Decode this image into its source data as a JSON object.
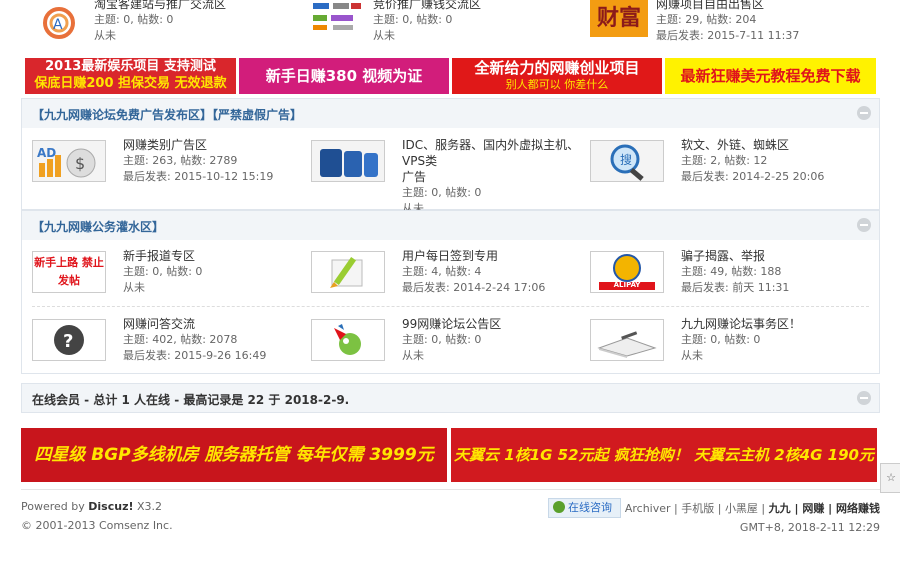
{
  "top_row": [
    {
      "name": "淘宝客建站与推广交流区",
      "stat": "主题: 0, 帖数: 0",
      "last": "从未"
    },
    {
      "name": "竞价推广赚钱交流区",
      "stat": "主题: 0, 帖数: 0",
      "last": "从未"
    },
    {
      "name": "网赚项目自由出售区",
      "stat": "主题: 29, 帖数: 204",
      "last": "最后发表: 2015-7-11 11:37"
    }
  ],
  "ads_top": [
    {
      "line1": "2013最新娱乐项目 支持测试",
      "line2": "保底日赚200 担保交易 无效退款",
      "bg": "#d9262c"
    },
    {
      "line1": "新手日赚380 视频为证",
      "line2": "",
      "bg": "#d21d7b"
    },
    {
      "line1": "全新给力的网赚创业项目",
      "line2": "别人都可以 你差什么",
      "bg": "#e01818"
    },
    {
      "line1": "最新狂赚美元教程免费下载",
      "line2": "",
      "bg": "#fff200"
    }
  ],
  "section1": {
    "title": "【九九网赚论坛免费广告发布区】【严禁虚假广告】"
  },
  "section1_forums": [
    {
      "name": "网赚类别广告区",
      "stat": "主题: 263, 帖数: 2789",
      "last": "最后发表: 2015-10-12 15:19",
      "icon": "ad-money-icon"
    },
    {
      "name": "IDC、服务器、国内外虚拟主机、VPS类",
      "name2": "广告",
      "stat": "主题: 0, 帖数: 0",
      "last": "从未",
      "icon": "server-icon"
    },
    {
      "name": "软文、外链、蜘蛛区",
      "stat": "主题: 2, 帖数: 12",
      "last": "最后发表: 2014-2-25 20:06",
      "icon": "magnifier-icon"
    }
  ],
  "section2": {
    "title": "【九九网赚公务灌水区】"
  },
  "section2_forums_row1": [
    {
      "name": "新手报道专区",
      "stat": "主题: 0, 帖数: 0",
      "last": "从未",
      "icon": "newbie-icon",
      "thumb_text": "新手上路 禁止发帖"
    },
    {
      "name": "用户每日签到专用",
      "stat": "主题: 4, 帖数: 4",
      "last": "最后发表: 2014-2-24 17:06",
      "icon": "pencil-icon"
    },
    {
      "name": "骗子揭露、举报",
      "stat": "主题: 49, 帖数: 188",
      "last": "最后发表: 前天 11:31",
      "icon": "alipay-icon",
      "thumb_text": "ALIPAY"
    }
  ],
  "section2_forums_row2": [
    {
      "name": "网赚问答交流",
      "stat": "主题: 402, 帖数: 2078",
      "last": "最后发表: 2015-9-26 16:49",
      "icon": "question-icon"
    },
    {
      "name": "99网赚论坛公告区",
      "stat": "主题: 0, 帖数: 0",
      "last": "从未",
      "icon": "megaphone-icon"
    },
    {
      "name": "九九网赚论坛事务区！",
      "stat": "主题: 0, 帖数: 0",
      "last": "从未",
      "icon": "book-icon"
    }
  ],
  "online": {
    "text": "在线会员 - 总计 1 人在线 - 最高记录是 22 于 2018-2-9."
  },
  "ads_bottom": [
    {
      "text": "四星级 BGP多线机房 服务器托管 每年仅需 3999元",
      "bg": "#c8151c"
    },
    {
      "text": "天翼云 1核1G 52元起 疯狂抢购！ 天翼云主机 2核4G 190元起",
      "bg": "#d11a1f"
    }
  ],
  "footer": {
    "powered": "Powered by",
    "brand": "Discuz!",
    "version": "X3.2",
    "copyright": "© 2001-2013 Comsenz Inc.",
    "consult": "在线咨询",
    "links": [
      "Archiver",
      "手机版",
      "小黑屋",
      "九九 | 网赚 | 网络赚钱"
    ],
    "time": "GMT+8, 2018-2-11 12:29"
  },
  "colors": {
    "section_bg": "#f2f5f8",
    "section_border": "#dfe5ec",
    "section_title": "#336699"
  }
}
